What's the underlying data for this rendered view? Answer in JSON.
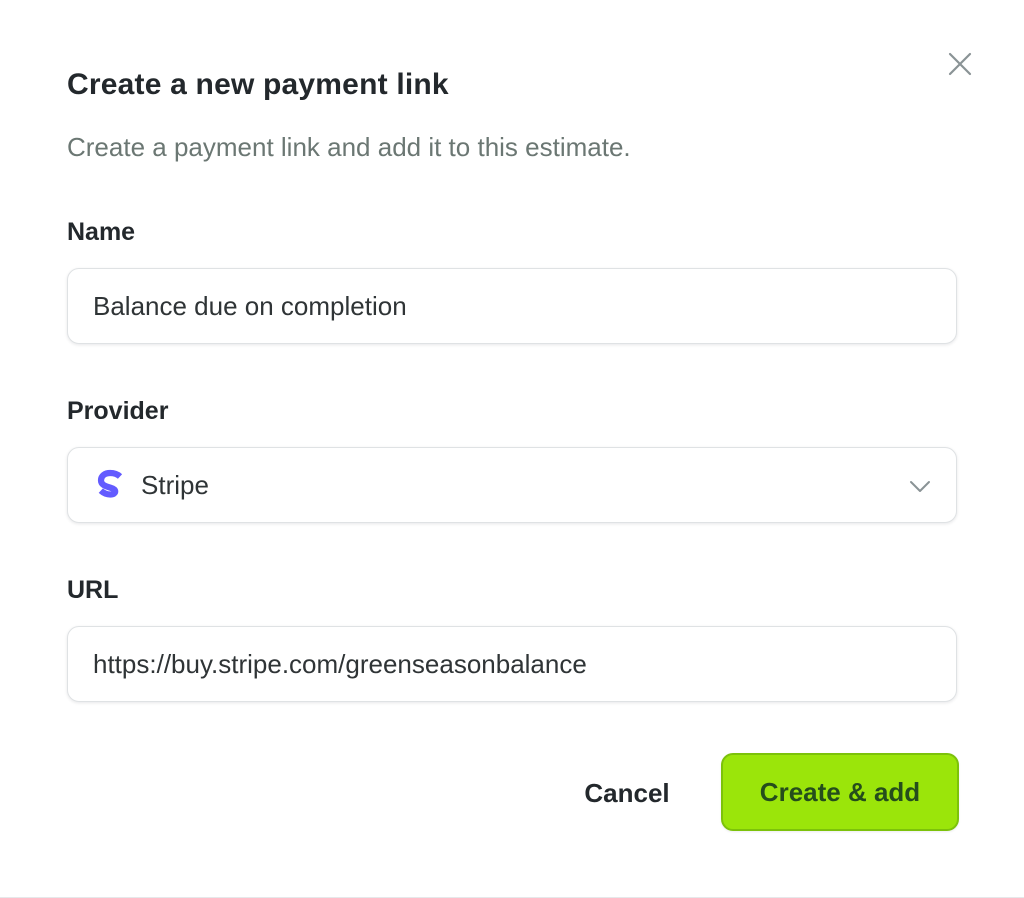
{
  "dialog": {
    "title": "Create a new payment link",
    "subtitle": "Create a payment link and add it to this estimate.",
    "close_icon": "close-icon"
  },
  "form": {
    "name": {
      "label": "Name",
      "value": "Balance due on completion"
    },
    "provider": {
      "label": "Provider",
      "value": "Stripe",
      "icon": "stripe-logo-icon",
      "icon_color": "#635bff",
      "dropdown_icon": "chevron-down-icon"
    },
    "url": {
      "label": "URL",
      "value": "https://buy.stripe.com/greenseasonbalance"
    }
  },
  "actions": {
    "cancel_label": "Cancel",
    "submit_label": "Create & add",
    "submit_color": "#9be50a"
  }
}
